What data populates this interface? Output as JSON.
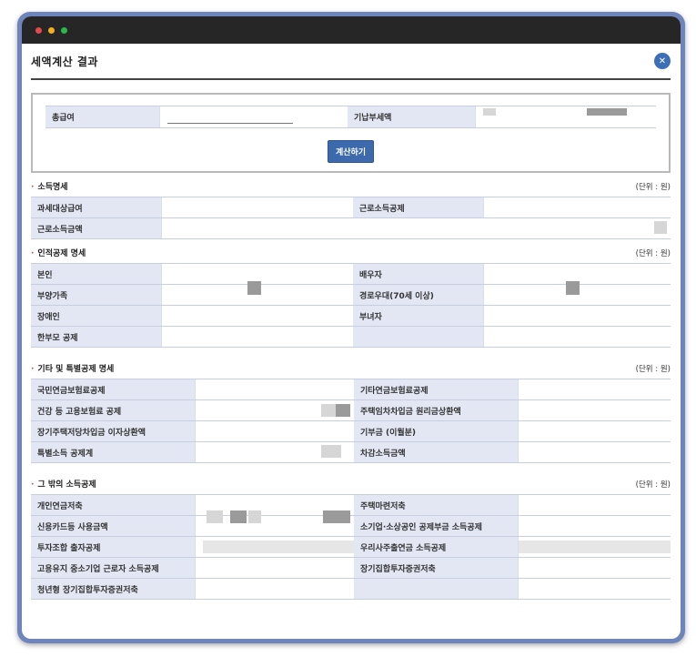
{
  "window": {
    "title": "세액계산 결과"
  },
  "close_icon": "close-icon",
  "calc": {
    "total_salary_label": "총급여",
    "total_salary_value": "",
    "paid_tax_label": "기납부세액",
    "paid_tax_value": "",
    "calculate_button": "계산하기"
  },
  "sections": {
    "income": {
      "title": "소득명세",
      "unit": "(단위 : 원)",
      "rows": [
        [
          "과세대상급여",
          "근로소득공제"
        ],
        [
          "근로소득금액"
        ]
      ]
    },
    "personal": {
      "title": "인적공제 명세",
      "unit": "(단위 : 원)",
      "rows": [
        [
          "본인",
          "배우자"
        ],
        [
          "부양가족",
          "경로우대(70세 이상)"
        ],
        [
          "장애인",
          "부녀자"
        ],
        [
          "한부모 공제",
          ""
        ]
      ]
    },
    "other": {
      "title": "기타 및 특별공제 명세",
      "unit": "(단위 : 원)",
      "rows": [
        [
          "국민연금보험료공제",
          "기타연금보험료공제"
        ],
        [
          "건강 등 고용보험료 공제",
          "주택임차차입금 원리금상환액"
        ],
        [
          "장기주택저당차입금 이자상환액",
          "기부금 (이월분)"
        ],
        [
          "특별소득 공제계",
          "차감소득금액"
        ]
      ]
    },
    "extra": {
      "title": "그 밖의 소득공제",
      "unit": "(단위 : 원)",
      "rows": [
        [
          "개인연금저축",
          "주택마련저축"
        ],
        [
          "신용카드등 사용금액",
          "소기업·소상공인 공제부금 소득공제"
        ],
        [
          "투자조합 출자공제",
          "우리사주출연금 소득공제"
        ],
        [
          "고용유지 중소기업 근로자 소득공제",
          "장기집합투자증권저축"
        ],
        [
          "청년형 장기집합투자증권저축",
          ""
        ]
      ]
    }
  }
}
